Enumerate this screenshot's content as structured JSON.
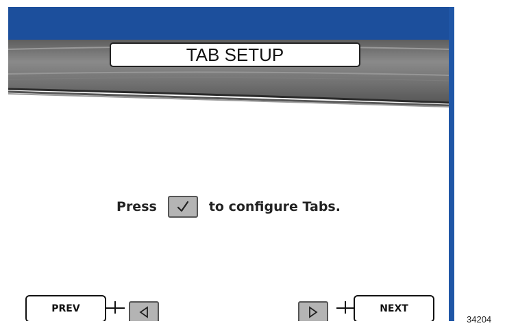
{
  "header": {
    "title": "TAB SETUP"
  },
  "main": {
    "instruction_prefix": "Press",
    "instruction_suffix": "to configure Tabs.",
    "key_icon": "checkmark-icon"
  },
  "footer": {
    "prev_label": "PREV",
    "next_label": "NEXT",
    "left_icon": "triangle-left-icon",
    "right_icon": "triangle-right-icon"
  },
  "figure_number": "34204",
  "colors": {
    "top_bar": "#1c4f9c",
    "bezel": "#6e6e6e",
    "key_fill": "#b4b4b4"
  }
}
